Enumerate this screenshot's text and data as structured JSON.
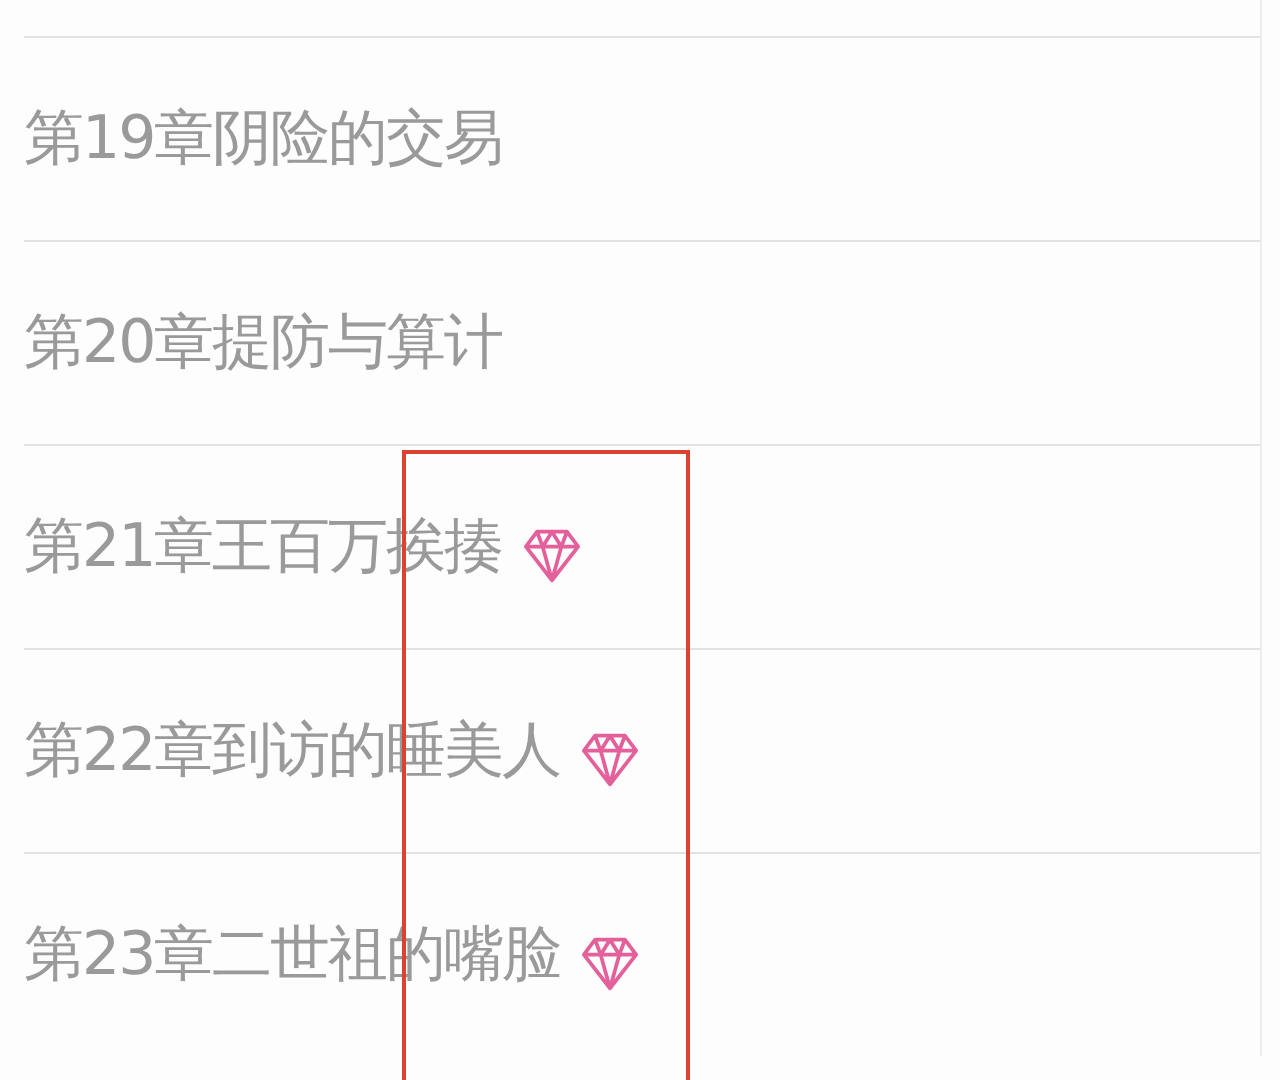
{
  "chapters": [
    {
      "title": "第19章阴险的交易",
      "vip": false
    },
    {
      "title": "第20章提防与算计",
      "vip": false
    },
    {
      "title": "第21章王百万挨揍",
      "vip": true
    },
    {
      "title": "第22章到访的睡美人",
      "vip": true
    },
    {
      "title": "第23章二世祖的嘴脸",
      "vip": true
    }
  ]
}
